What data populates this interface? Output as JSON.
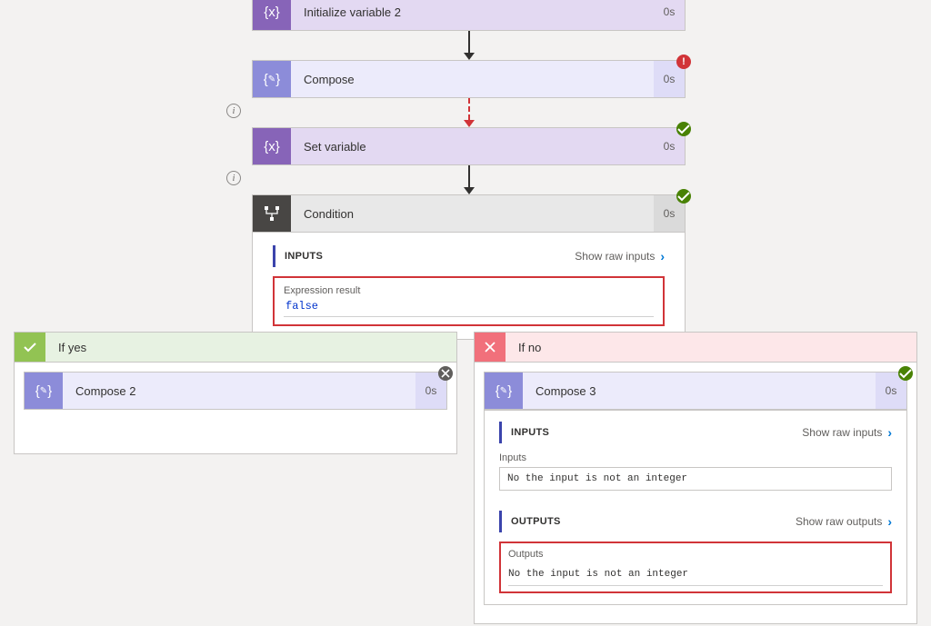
{
  "steps": {
    "init2": {
      "title": "Initialize variable 2",
      "time": "0s"
    },
    "compose": {
      "title": "Compose",
      "time": "0s"
    },
    "setvar": {
      "title": "Set variable",
      "time": "0s"
    },
    "condition": {
      "title": "Condition",
      "time": "0s"
    }
  },
  "condition_panel": {
    "inputs_label": "INPUTS",
    "show_raw_inputs": "Show raw inputs",
    "expr_label": "Expression result",
    "expr_value": "false"
  },
  "if_yes": {
    "header": "If yes",
    "compose2": {
      "title": "Compose 2",
      "time": "0s"
    }
  },
  "if_no": {
    "header": "If no",
    "compose3": {
      "title": "Compose 3",
      "time": "0s"
    },
    "panel": {
      "inputs_label": "INPUTS",
      "show_raw_inputs": "Show raw inputs",
      "inputs_field_label": "Inputs",
      "inputs_value": "No the input is not an integer",
      "outputs_label": "OUTPUTS",
      "show_raw_outputs": "Show raw outputs",
      "outputs_field_label": "Outputs",
      "outputs_value": "No the input is not an integer"
    }
  }
}
